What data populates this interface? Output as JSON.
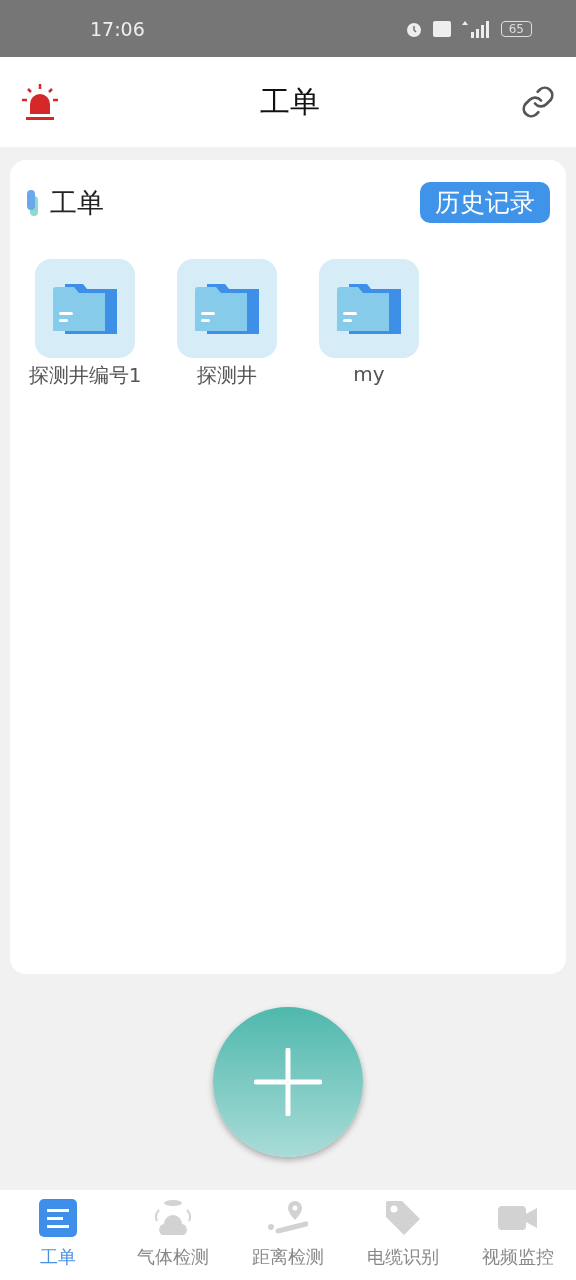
{
  "status_bar": {
    "time": "17:06",
    "battery": "65"
  },
  "header": {
    "title": "工单"
  },
  "card": {
    "title": "工单",
    "history_button": "历史记录",
    "folders": [
      {
        "label": "探测井编号1"
      },
      {
        "label": "探测井"
      },
      {
        "label": "my"
      }
    ]
  },
  "tabs": [
    {
      "label": "工单",
      "kind": "list",
      "selected": true
    },
    {
      "label": "气体检测",
      "kind": "gas",
      "selected": false
    },
    {
      "label": "距离检测",
      "kind": "distance",
      "selected": false
    },
    {
      "label": "电缆识别",
      "kind": "tag",
      "selected": false
    },
    {
      "label": "视频监控",
      "kind": "video",
      "selected": false
    }
  ]
}
